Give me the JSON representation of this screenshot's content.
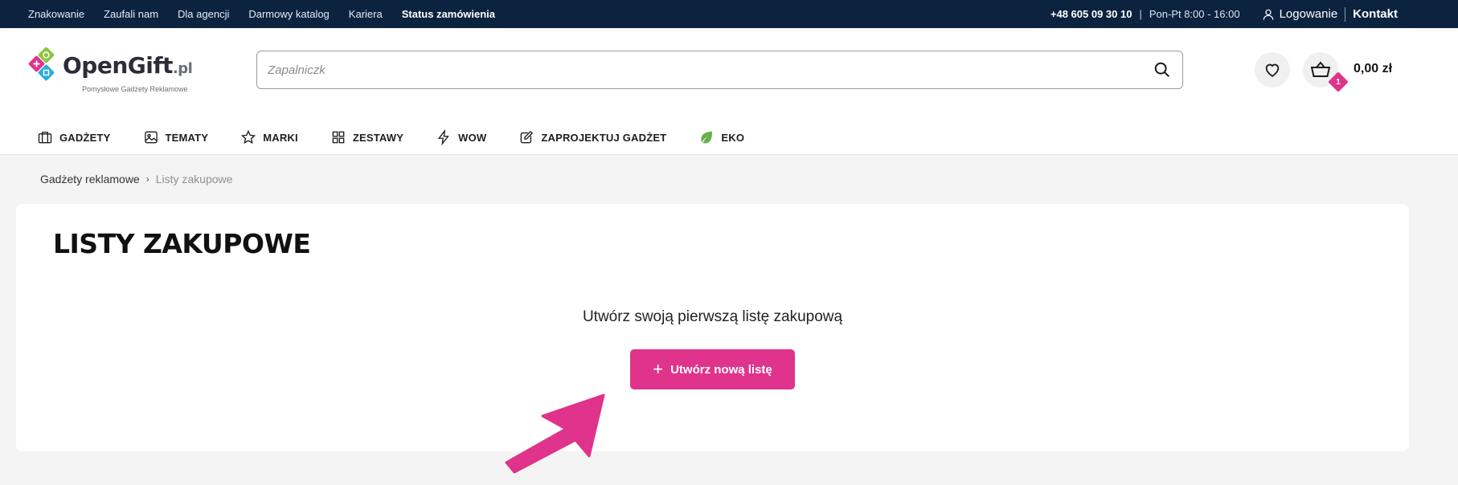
{
  "topbar": {
    "links": [
      "Znakowanie",
      "Zaufali nam",
      "Dla agencji",
      "Darmowy katalog",
      "Kariera"
    ],
    "status_link": "Status zamówienia",
    "phone": "+48 605 09 30 10",
    "separator": "|",
    "hours": "Pon-Pt 8:00 - 16:00",
    "login": "Logowanie",
    "contact": "Kontakt"
  },
  "logo": {
    "name_main": "OpenGift",
    "name_suffix": ".pl",
    "tagline": "Pomysłowe Gadżety Reklamowe"
  },
  "search": {
    "placeholder": "Zapalniczk"
  },
  "cart": {
    "count": "1",
    "amount": "0,00 zł"
  },
  "nav": {
    "items": [
      {
        "label": "GADŻETY",
        "icon": "briefcase-icon"
      },
      {
        "label": "TEMATY",
        "icon": "image-icon"
      },
      {
        "label": "MARKI",
        "icon": "star-icon"
      },
      {
        "label": "ZESTAWY",
        "icon": "grid-icon"
      },
      {
        "label": "WOW",
        "icon": "lightning-icon"
      },
      {
        "label": "ZAPROJEKTUJ GADŻET",
        "icon": "edit-icon"
      },
      {
        "label": "EKO",
        "icon": "leaf-icon"
      }
    ]
  },
  "breadcrumb": {
    "home": "Gadżety reklamowe",
    "current": "Listy zakupowe"
  },
  "main": {
    "title": "LISTY ZAKUPOWE",
    "empty_text": "Utwórz swoją pierwszą listę zakupową",
    "create_button": "Utwórz nową listę"
  },
  "colors": {
    "topbar_bg": "#0c2340",
    "accent_pink": "#e0338b",
    "eko_green": "#6ab04c",
    "page_bg": "#f4f4f4"
  }
}
